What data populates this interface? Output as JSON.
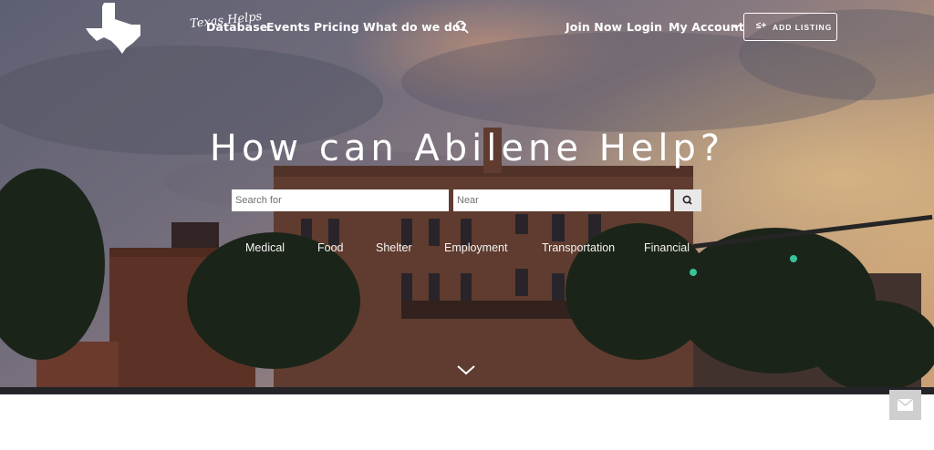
{
  "brand": {
    "logo_text": "Texas Helps"
  },
  "nav": {
    "links": [
      "Database",
      "Events",
      "Pricing",
      "What do we do?"
    ],
    "join": "Join Now",
    "login": "Login",
    "account": "My Account",
    "add_listing": "ADD LISTING"
  },
  "hero": {
    "headline": "How can Abilene Help?",
    "search_placeholder": "Search for",
    "near_placeholder": "Near",
    "categories": [
      "Medical",
      "Food",
      "Shelter",
      "Employment",
      "Transportation",
      "Financial"
    ]
  },
  "icons": {
    "nav_search": "search-icon",
    "account_dropdown": "chevron-down-icon",
    "add_listing": "user-plus-icon",
    "search_button": "search-icon",
    "scroll_down": "chevron-down-icon",
    "contact": "envelope-icon"
  },
  "colors": {
    "text": "#ffffff",
    "search_button_bg": "#e8e8e8",
    "mail_button_bg": "#cfcfcf"
  }
}
